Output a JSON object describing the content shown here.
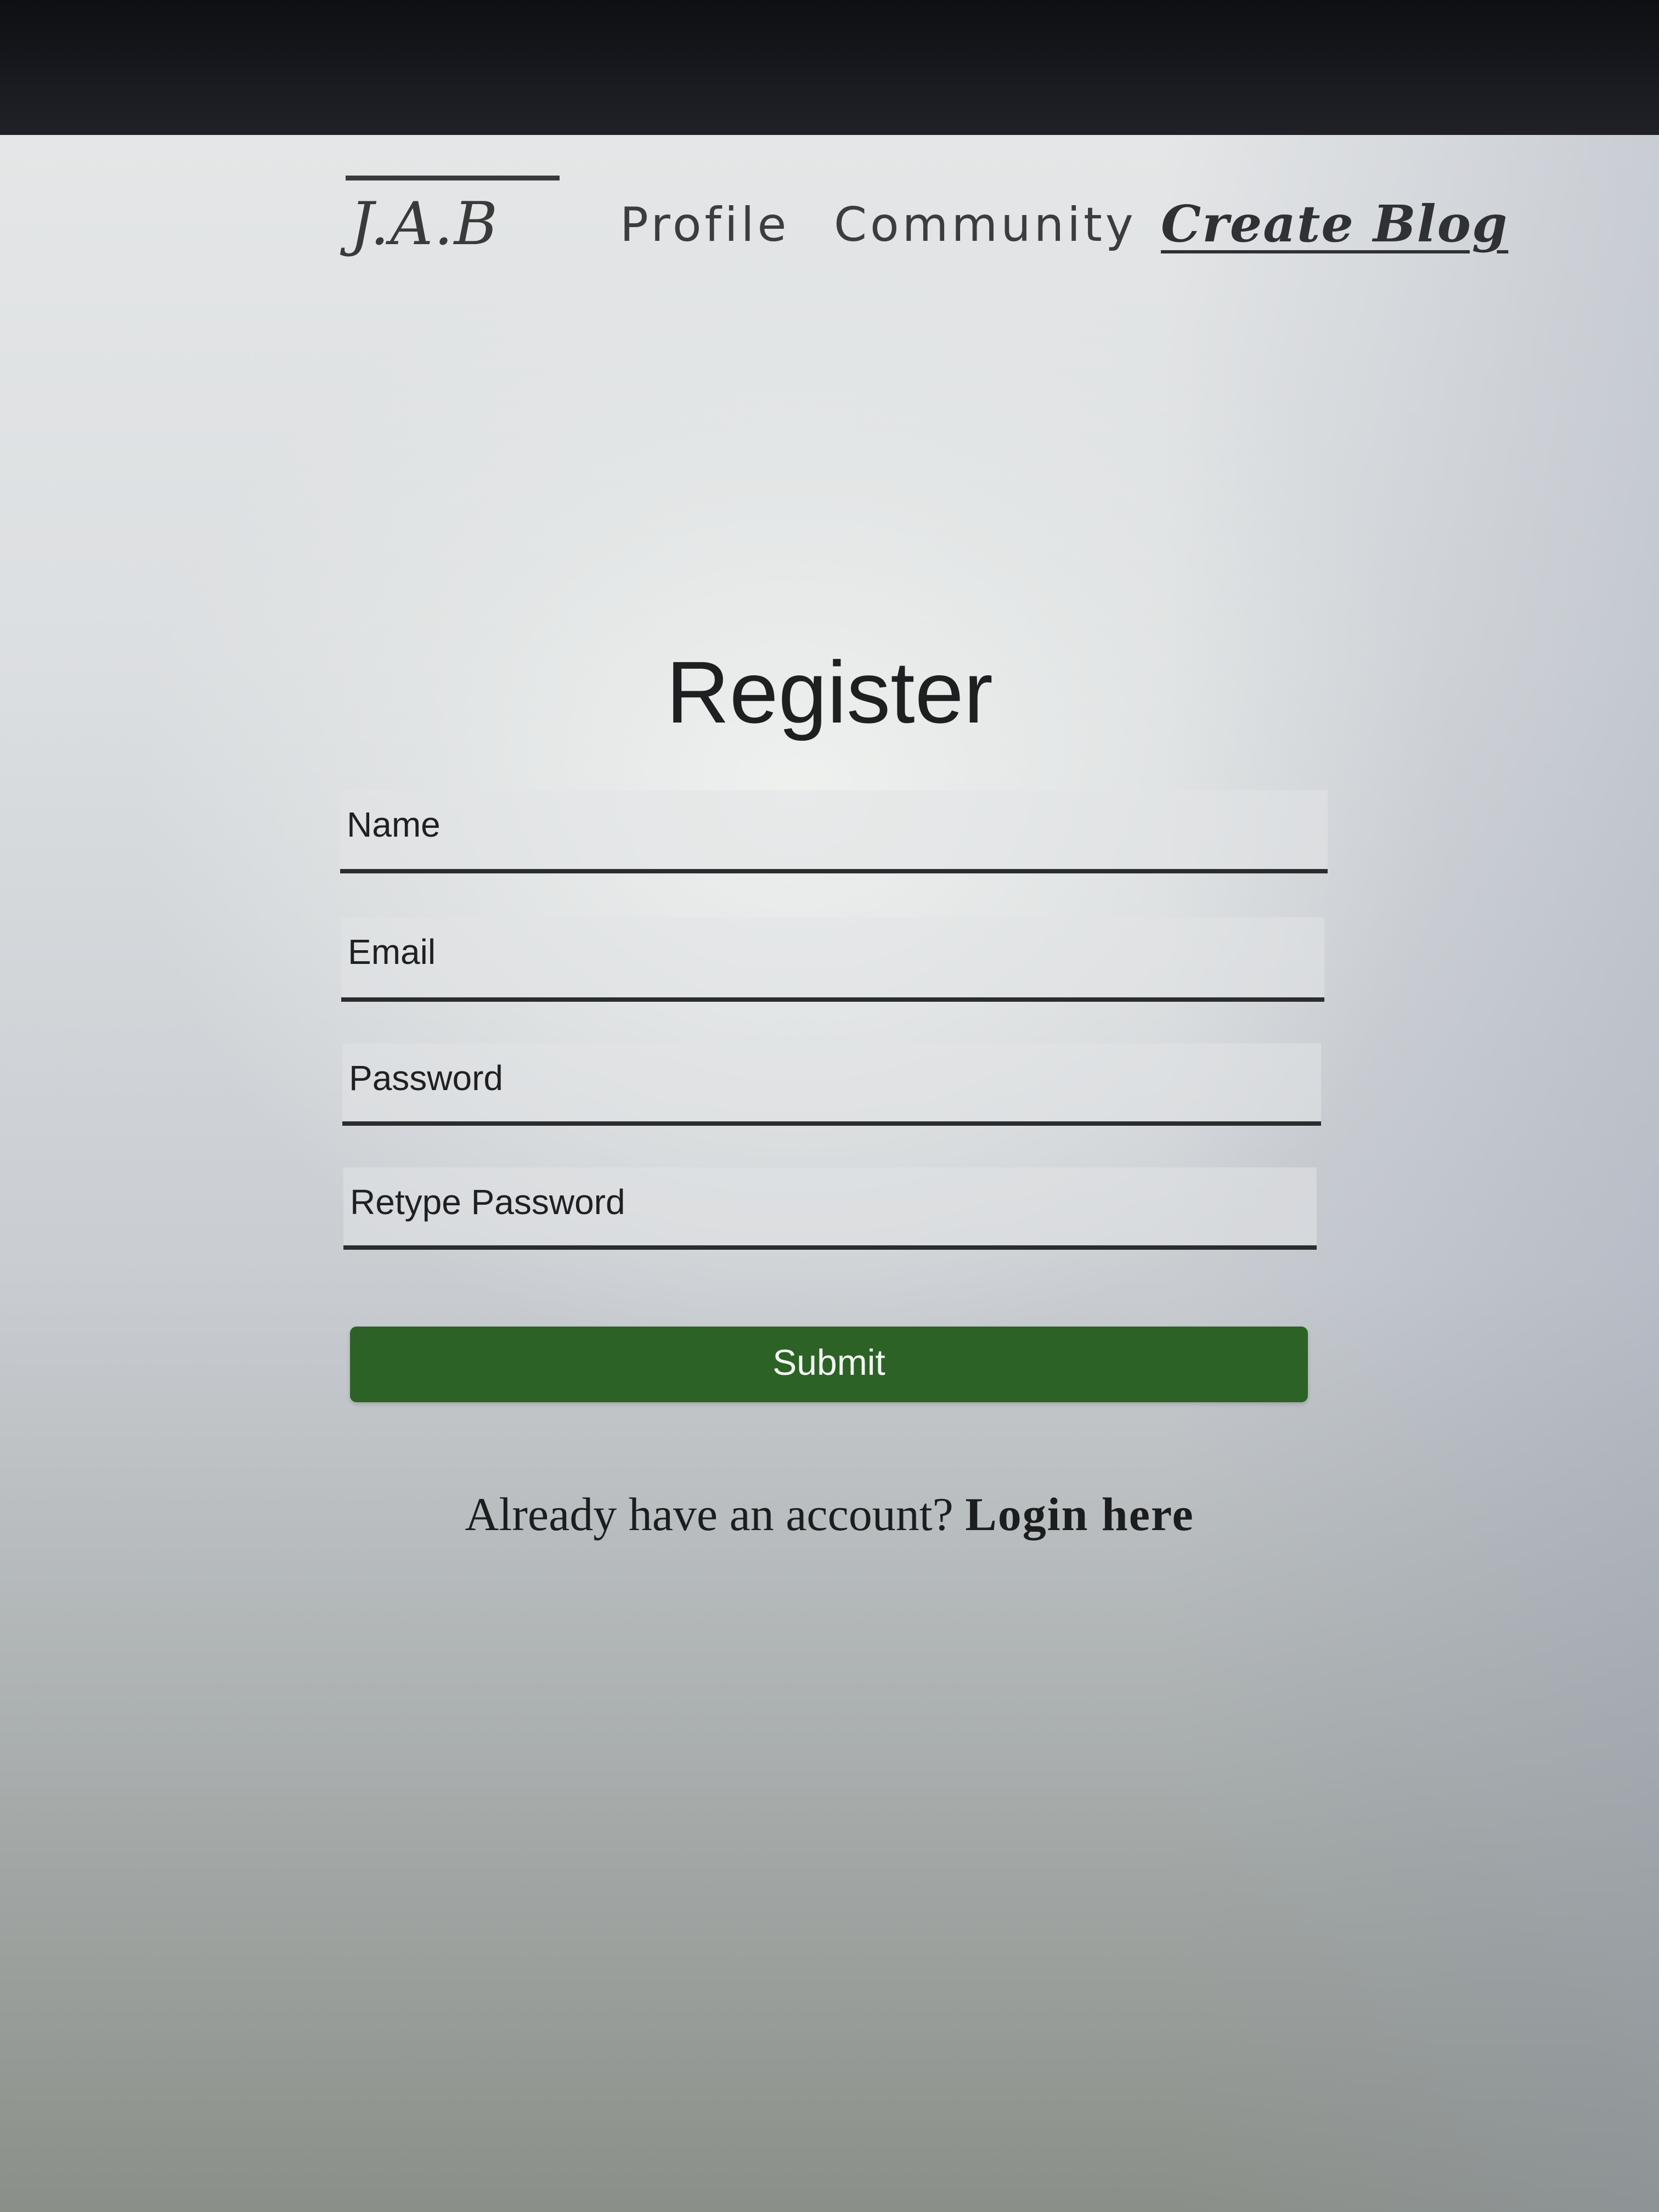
{
  "nav": {
    "logo": "J.A.B",
    "links": [
      {
        "label": "Profile"
      },
      {
        "label": "Community"
      },
      {
        "label": "Create Blog"
      }
    ]
  },
  "form": {
    "title": "Register",
    "fields": [
      {
        "placeholder": "Name",
        "value": ""
      },
      {
        "placeholder": "Email",
        "value": ""
      },
      {
        "placeholder": "Password",
        "value": ""
      },
      {
        "placeholder": "Retype Password",
        "value": ""
      }
    ],
    "submit_label": "Submit",
    "login_prompt": "Already have an account?",
    "login_link": "Login here"
  },
  "colors": {
    "submit_button": "#2c6226",
    "text": "#1e1f21"
  }
}
